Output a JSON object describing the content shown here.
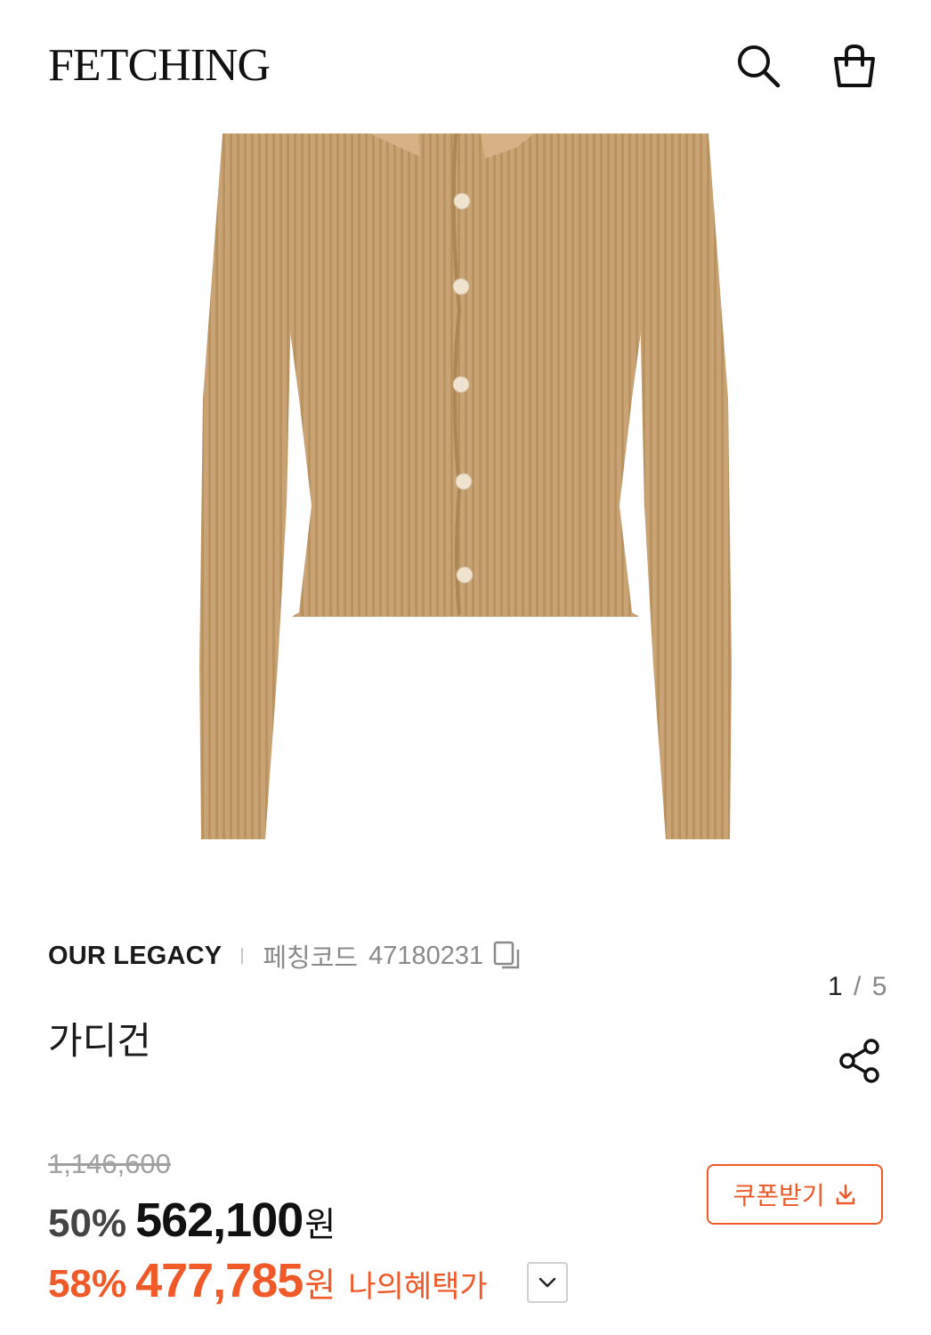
{
  "header": {
    "logo": "FETCHING",
    "search_icon": "search-icon",
    "cart_icon": "shopping-bag-icon"
  },
  "gallery": {
    "current_index": "1",
    "separator": "/",
    "total": "5",
    "image_subject": "beige ribbed knit cardigan",
    "image_color": "#c8a274"
  },
  "product": {
    "brand": "OUR LEGACY",
    "code_label": "페칭코드",
    "code_value": "47180231",
    "name": "가디건"
  },
  "pricing": {
    "original_price": "1,146,600",
    "discount_percent": "50%",
    "sale_price": "562,100",
    "currency": "원",
    "benefit_percent": "58%",
    "benefit_price": "477,785",
    "benefit_label": "나의혜택가",
    "coupon_button_label": "쿠폰받기"
  },
  "colors": {
    "accent": "#f05a28",
    "text": "#111111",
    "muted": "#8a8a8a"
  }
}
